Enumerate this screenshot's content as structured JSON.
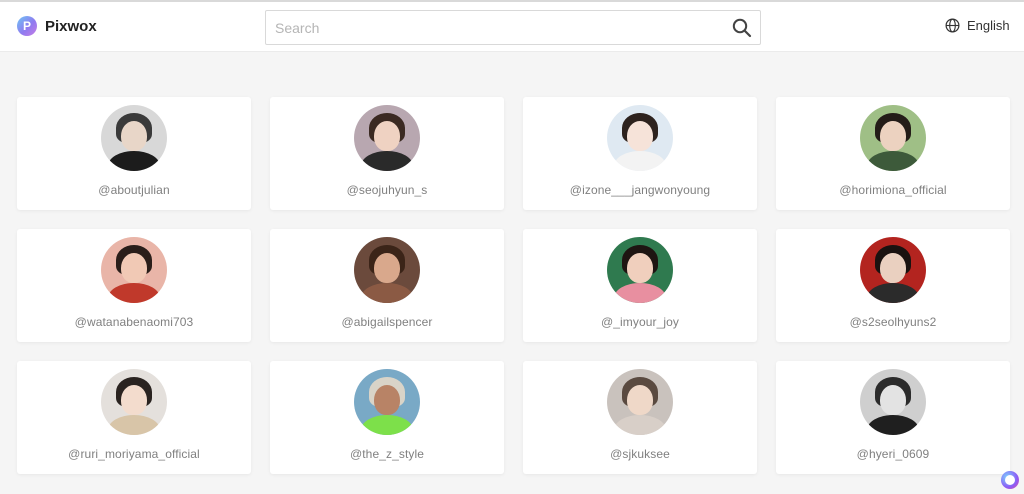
{
  "app": {
    "logo_letter": "P",
    "name": "Pixwox"
  },
  "search": {
    "placeholder": "Search",
    "value": ""
  },
  "language": {
    "label": "English",
    "icon": "globe-icon"
  },
  "profiles": [
    {
      "handle": "@aboutjulian",
      "bg": "#d8d8d8",
      "hair": "#3a3a3a",
      "skin": "#e8d6c8",
      "body": "#1c1c1c"
    },
    {
      "handle": "@seojuhyun_s",
      "bg": "#b8a7b0",
      "hair": "#3b2a22",
      "skin": "#efd2c2",
      "body": "#2a2a2a"
    },
    {
      "handle": "@izone___jangwonyoung",
      "bg": "#dfe9f2",
      "hair": "#2d221e",
      "skin": "#f6e3d9",
      "body": "#f3f3f3"
    },
    {
      "handle": "@horimiona_official",
      "bg": "#9fbf86",
      "hair": "#231c18",
      "skin": "#ecd2c0",
      "body": "#3d5a3a"
    },
    {
      "handle": "@watanabenaomi703",
      "bg": "#e9b5a8",
      "hair": "#2a1e1a",
      "skin": "#f1c9b5",
      "body": "#c0392b"
    },
    {
      "handle": "@abigailspencer",
      "bg": "#6b4a3c",
      "hair": "#3b2418",
      "skin": "#d9a88c",
      "body": "#8b5a44"
    },
    {
      "handle": "@_imyour_joy",
      "bg": "#2f7a4f",
      "hair": "#1e1512",
      "skin": "#f0cfbd",
      "body": "#e88fa0"
    },
    {
      "handle": "@s2seolhyuns2",
      "bg": "#b3241f",
      "hair": "#1a1210",
      "skin": "#ead0c0",
      "body": "#2b2b2b"
    },
    {
      "handle": "@ruri_moriyama_official",
      "bg": "#e4e0dc",
      "hair": "#2a2320",
      "skin": "#f3dccd",
      "body": "#d8c5a8"
    },
    {
      "handle": "@the_z_style",
      "bg": "#79a9c6",
      "hair": "#d9d4c8",
      "skin": "#b88366",
      "body": "#7de04a"
    },
    {
      "handle": "@sjkuksee",
      "bg": "#c9c2bd",
      "hair": "#5a4a40",
      "skin": "#efd8c8",
      "body": "#d8cfc8"
    },
    {
      "handle": "@hyeri_0609",
      "bg": "#cfcfcf",
      "hair": "#2b2b2b",
      "skin": "#e3e3e3",
      "body": "#1f1f1f"
    }
  ]
}
